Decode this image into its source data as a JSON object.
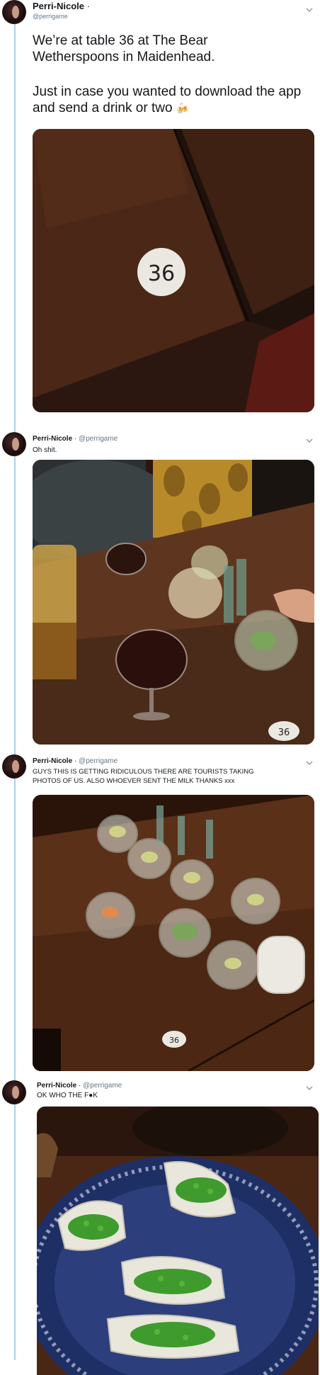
{
  "thread": [
    {
      "author_name": "Perri-Nicole",
      "separator": "·",
      "handle": "@perrigame",
      "text_line1": "We’re at table 36 at The Bear Wetherspoons in Maidenhead.",
      "text_line2": "Just in case you wanted to download the app and send a drink or two",
      "emoji": "🍻",
      "photo_table_number": "36"
    },
    {
      "author_name": "Perri-Nicole",
      "separator": "·",
      "handle": "@perrigame",
      "text": "Oh shit.",
      "photo_table_number": "36"
    },
    {
      "author_name": "Perri-Nicole",
      "separator": "·",
      "handle": "@perrigame",
      "text": "GUYS THIS IS GETTING RIDICULOUS THERE ARE TOURISTS TAKING PHOTOS OF US. ALSO WHOEVER SENT THE MILK THANKS xxx",
      "photo_table_number": "36"
    },
    {
      "author_name": "Perri-Nicole",
      "separator": "·",
      "handle": "@perrigame",
      "text": "OK WHO THE F●K"
    }
  ],
  "icons": {
    "caret": "chevron-down-icon"
  },
  "colors": {
    "thread_line": "#a8d3f0",
    "handle": "#657786",
    "text": "#14171a"
  }
}
